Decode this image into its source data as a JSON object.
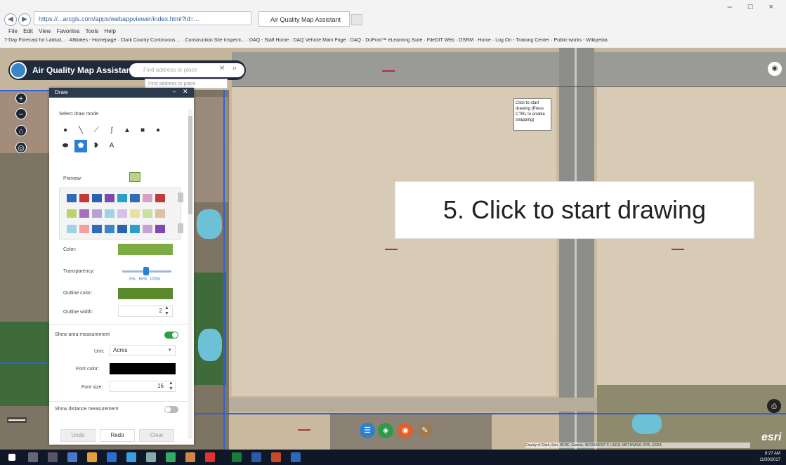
{
  "browser": {
    "address_url": "https://...arcgis.com/apps/webappviewer/index.html?id=...",
    "tab_title": "Air Quality Map Assistant",
    "menu_items": [
      "File",
      "Edit",
      "View",
      "Favorites",
      "Tools",
      "Help"
    ],
    "favorites": [
      "7-Day Forecast for Latitud...",
      "Affiliates - Homepage",
      "Clark County Continuous ...",
      "Construction Site Inspecti...",
      "DAQ - Staff Home",
      "DAQ Vehicle Main Page",
      "DAQ",
      "DuPont™ eLearning Suite",
      "FileOIT Web",
      "OSRM",
      "Home",
      "Log On - Training Center",
      "Public-works - Wikipedia"
    ]
  },
  "app": {
    "title": "Air Quality Map Assistant",
    "search_placeholder": "Find address or place",
    "search_suggestion": "Find address or place"
  },
  "draw_panel": {
    "title": "Draw",
    "select_mode_label": "Select draw mode",
    "preview_label": "Preview:",
    "color_label": "Color:",
    "transparency_label": "Transparency:",
    "transparency_ticks": "0%   50%  100%",
    "outline_color_label": "Outline color:",
    "outline_width_label": "Outline width:",
    "outline_width_value": "2",
    "show_area_label": "Show area measurement",
    "unit_label": "Unit:",
    "unit_value": "Acres",
    "font_color_label": "Font color:",
    "font_size_label": "Font size:",
    "font_size_value": "16",
    "show_distance_label": "Show distance measurement",
    "undo_label": "Undo",
    "redo_label": "Redo",
    "clear_label": "Clear",
    "colors": {
      "fill": "#7cab44",
      "outline": "#5a8a2c",
      "font": "#000000"
    },
    "modes": [
      "pin-icon",
      "line-icon",
      "polyline-icon",
      "freehand-line-icon",
      "triangle-icon",
      "rectangle-icon",
      "circle-icon",
      "ellipse-icon",
      "polygon-icon",
      "freehand-polygon-icon",
      "text-icon"
    ]
  },
  "map": {
    "tooltip_text": "Click to start drawing (Press CTRL to enable snapping)",
    "callout_text": "5. Click to start drawing",
    "esri_logo": "esri",
    "attribution": "County of Clark, Esri, HERE, Garmin, INCREMENT P, USGS, METI/NASA, EPA, USDA"
  },
  "taskbar": {
    "time": "8:27 AM",
    "date": "11/30/2017"
  }
}
